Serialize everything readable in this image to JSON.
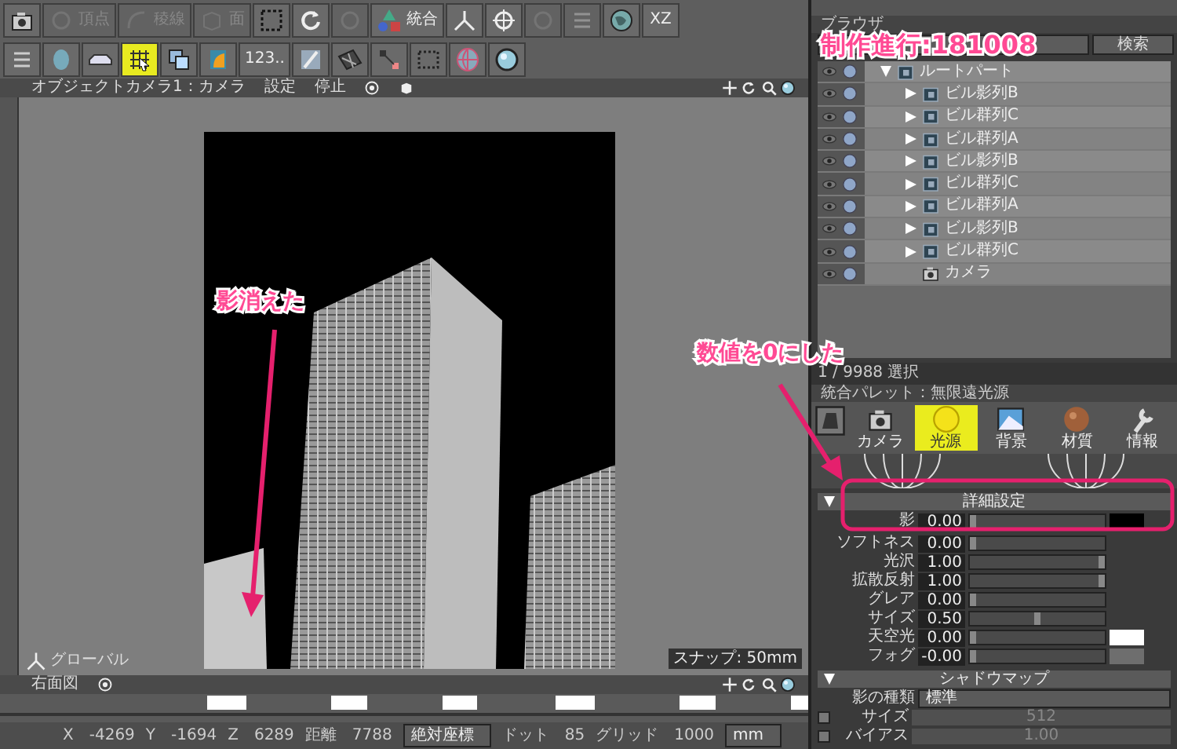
{
  "toolbar_1": [
    {
      "kind": "camera",
      "disabled": false
    },
    {
      "kind": "ring",
      "label": "頂点",
      "disabled": true
    },
    {
      "kind": "arc",
      "label": "稜線",
      "disabled": true
    },
    {
      "kind": "cube",
      "label": "面",
      "disabled": true
    },
    {
      "kind": "dashed-square",
      "disabled": false
    },
    {
      "kind": "rotate",
      "disabled": false
    },
    {
      "kind": "ring",
      "disabled": true
    },
    {
      "kind": "shapes",
      "label": "統合",
      "disabled": false
    },
    {
      "kind": "axes",
      "disabled": false
    },
    {
      "kind": "crosshair",
      "disabled": false
    },
    {
      "kind": "ring",
      "disabled": true
    },
    {
      "kind": "lines",
      "disabled": true
    },
    {
      "kind": "globe",
      "disabled": false
    },
    {
      "kind": "text",
      "label": "XZ",
      "disabled": false
    }
  ],
  "toolbar_2": [
    {
      "kind": "lines",
      "selected": false
    },
    {
      "kind": "head",
      "selected": false
    },
    {
      "kind": "car",
      "selected": false
    },
    {
      "kind": "grid-cursor",
      "selected": true
    },
    {
      "kind": "squares",
      "selected": false
    },
    {
      "kind": "document",
      "selected": false
    },
    {
      "kind": "text",
      "label": "123..",
      "selected": false
    },
    {
      "kind": "pen",
      "selected": false
    },
    {
      "kind": "plane",
      "selected": false
    },
    {
      "kind": "nodes",
      "selected": false
    },
    {
      "kind": "mesh",
      "selected": false
    },
    {
      "kind": "sphere-grid",
      "selected": false
    },
    {
      "kind": "sphere",
      "selected": false
    }
  ],
  "perspective_view": {
    "camera_menu": "オブジェクトカメラ1：カメラ",
    "settings_menu": "設定",
    "stop": "停止",
    "coordinate_label": "グローバル",
    "snap": "スナップ: 50mm"
  },
  "side_view": {
    "title": "右面図"
  },
  "status_bar": [
    {
      "kind": "pair",
      "label": "X",
      "value": "-4269"
    },
    {
      "kind": "pair",
      "label": "Y",
      "value": "-1694"
    },
    {
      "kind": "pair",
      "label": "Z",
      "value": "6289"
    },
    {
      "kind": "pair",
      "label": "距離",
      "value": "7788"
    },
    {
      "kind": "dropdown",
      "value": "絶対座標"
    },
    {
      "kind": "pair",
      "label": "ドット",
      "value": "85"
    },
    {
      "kind": "pair",
      "label": "グリッド",
      "value": "1000"
    },
    {
      "kind": "dropdown",
      "value": "mm"
    }
  ],
  "browser": {
    "title": "ブラウザ",
    "search_tab": "検索",
    "tree": [
      {
        "label": "ルートパート",
        "kind": "part",
        "expanded": true,
        "children": [
          {
            "label": "ビル影列B",
            "kind": "part",
            "expanded": false
          },
          {
            "label": "ビル群列C",
            "kind": "part",
            "expanded": false
          },
          {
            "label": "ビル群列A",
            "kind": "part",
            "expanded": false
          },
          {
            "label": "ビル影列B",
            "kind": "part",
            "expanded": false
          },
          {
            "label": "ビル群列C",
            "kind": "part",
            "expanded": false
          },
          {
            "label": "ビル群列A",
            "kind": "part",
            "expanded": false
          },
          {
            "label": "ビル影列B",
            "kind": "part",
            "expanded": false
          },
          {
            "label": "ビル群列C",
            "kind": "part",
            "expanded": false
          },
          {
            "label": "カメラ",
            "kind": "camera"
          }
        ]
      }
    ],
    "selection": "1 / 9988 選択"
  },
  "palette": {
    "title": "統合パレット：無限遠光源",
    "tabs": [
      {
        "label": "カメラ",
        "kind": "camera",
        "selected": false
      },
      {
        "label": "光源",
        "kind": "sun",
        "selected": true
      },
      {
        "label": "背景",
        "kind": "landscape",
        "selected": false
      },
      {
        "label": "材質",
        "kind": "ball",
        "selected": false
      },
      {
        "label": "情報",
        "kind": "wrench",
        "selected": false
      }
    ],
    "detail_section": {
      "title": "詳細設定",
      "expanded": true,
      "rows": [
        {
          "label": "影",
          "value": "0.00",
          "level": 0,
          "color": "#000000"
        },
        {
          "label": "ソフトネス",
          "value": "0.00",
          "level": 0
        },
        {
          "label": "光沢",
          "value": "1.00",
          "level": 1
        },
        {
          "label": "拡散反射",
          "value": "1.00",
          "level": 1
        },
        {
          "label": "グレア",
          "value": "0.00",
          "level": 0
        },
        {
          "label": "サイズ",
          "value": "0.50",
          "level": 0.5
        },
        {
          "label": "天空光",
          "value": "0.00",
          "level": 0,
          "color": "#ffffff"
        },
        {
          "label": "フォグ",
          "value": "-0.00",
          "level": 0,
          "color": "#6e6e6e"
        }
      ]
    },
    "shadow_section": {
      "title": "シャドウマップ",
      "expanded": true,
      "type_label": "影の種類",
      "type_value": "標準",
      "rows": [
        {
          "label": "サイズ",
          "value": "512",
          "checked": false,
          "disabled": true
        },
        {
          "label": "バイアス",
          "value": "1.00",
          "checked": false,
          "disabled": true
        }
      ]
    }
  },
  "annotations": [
    {
      "kind": "title",
      "text": "制作進行:181008"
    },
    {
      "kind": "callout",
      "text": "影消えた"
    },
    {
      "kind": "callout",
      "text": "数値を0にした"
    }
  ]
}
